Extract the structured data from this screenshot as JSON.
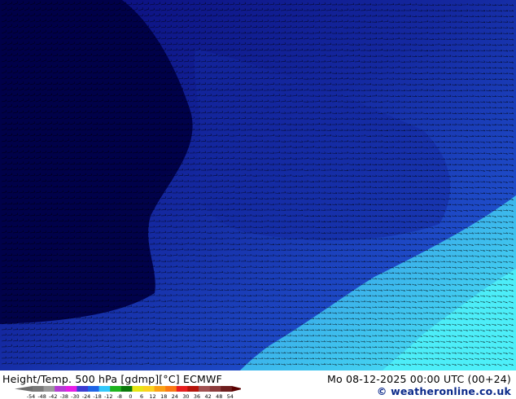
{
  "map": {
    "title": "Height/Temp. 500 hPa [gdmp][°C] ECMWF",
    "datetime": "Mo 08-12-2025 00:00 UTC (00+24)",
    "credit": "© weatheronline.co.uk"
  },
  "legend": {
    "ticks": [
      "-54",
      "-48",
      "-42",
      "-38",
      "-30",
      "-24",
      "-18",
      "-12",
      "-8",
      "0",
      "6",
      "12",
      "18",
      "24",
      "30",
      "36",
      "42",
      "48",
      "54"
    ],
    "colors": [
      "#7a7a7a",
      "#9a9a9a",
      "#b43cd2",
      "#e61ee6",
      "#3c3cd2",
      "#1e64e6",
      "#32c8fa",
      "#1eb41e",
      "#0a780a",
      "#e6e614",
      "#fad21e",
      "#faa014",
      "#fa7814",
      "#e61e1e",
      "#b4140a",
      "#a05050",
      "#8c3c3c",
      "#6e1e1e"
    ],
    "end_left_color": "#6e6e6e",
    "end_right_color": "#5a0000"
  },
  "field": {
    "colors": [
      "#000046",
      "#0a0a78",
      "#1428a0",
      "#1e4bc8",
      "#2f7ee0",
      "#3ec0ee",
      "#4ef0f8"
    ],
    "barb_color": "#000000"
  }
}
